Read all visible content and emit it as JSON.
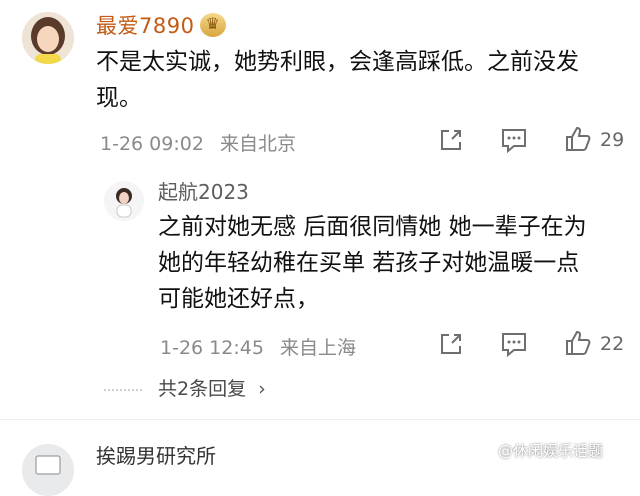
{
  "comment": {
    "author": "最爱7890",
    "text_line1": "不是太实诚，她势利眼，会逢高踩低。之前没发",
    "text_line2": "现。",
    "time": "1-26 09:02",
    "location": "来自北京",
    "likes": "29",
    "icons": [
      "share-icon",
      "comment-icon",
      "like-icon"
    ]
  },
  "reply": {
    "author": "起航2023",
    "text_line1": "之前对她无感 后面很同情她 她一辈子在为",
    "text_line2": "她的年轻幼稚在买单 若孩子对她温暖一点",
    "text_line3": "可能她还好点，",
    "time": "1-26 12:45",
    "location": "来自上海",
    "likes": "22",
    "icons": [
      "share-icon",
      "comment-icon",
      "like-icon"
    ]
  },
  "more_replies": "共2条回复",
  "next_comment": {
    "author": "挨踢男研究所"
  },
  "watermark": "@休闲娱乐话题",
  "colors": {
    "author_orange": "#c45a14",
    "meta_gray": "#8a8a8a",
    "background": "#ffffff"
  }
}
